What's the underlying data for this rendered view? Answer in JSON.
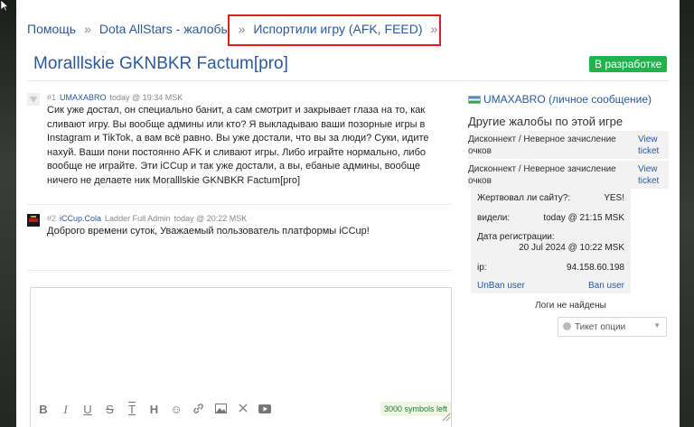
{
  "breadcrumbs": [
    {
      "label": "Помощь"
    },
    {
      "label": "Dota AllStars - жалобы"
    },
    {
      "label": "Испортили игру (AFK, FEED)"
    }
  ],
  "breadcrumb_separator": "»",
  "ticket": {
    "title": "Moralllskie GKNBKR Factum[pro]",
    "status": "В разработке"
  },
  "posts": [
    {
      "number": "#1",
      "author": "UMAXABRO",
      "role": "",
      "time": "today @ 19:34 MSK",
      "text": "Сик уже достал, он специально банит, а сам смотрит и закрывает глаза на то, как сливают игру. Вы вообще админы или кто? Я выкладываю ваши позорные игры в Instagram и TikTok, а вам всё равно. Вы уже достали, что вы за люди? Суки, идите нахуй. Ваши пони постоянно AFK и сливают игры. Либо играйте нормально, либо вообще не играйте. Эти iCCup и так уже достали, а вы, ебаные админы, вообще ничего не делаете ник Moralllskie GKNBKR Factum[pro]"
    },
    {
      "number": "#2",
      "author": "iCCup.Cola",
      "role": "Ladder Full Admin",
      "time": "today @ 20:22 MSK",
      "text": "Доброго времени суток, Уважаемый пользователь платформы iCCup!"
    }
  ],
  "editor": {
    "symbols_left": "3000 symbols left"
  },
  "sidebar": {
    "user_link": "UMAXABRO (личное сообщение)",
    "other_complaints_heading": "Другие жалобы по этой игре",
    "complaints": [
      {
        "text": "Дисконнект / Неверное зачисление очков",
        "link": "View ticket"
      },
      {
        "text": "Дисконнект / Неверное зачисление очков",
        "link": "View ticket"
      }
    ],
    "info": {
      "victim_label": "Жертвовал ли сайту?:",
      "victim_value": "YES!",
      "seen_label": "видели:",
      "seen_value": "today @ 21:15 MSK",
      "reg_label": "Дата регистрации:",
      "reg_value": "20 Jul 2024 @ 10:22 MSK",
      "ip_label": "ip:",
      "ip_value": "94.158.60.198"
    },
    "unban_link": "UnBan user",
    "ban_link": "Ban user",
    "no_logs": "Логи не найдены",
    "ticket_options": "Тикет опции"
  },
  "colors": {
    "link": "#2a5a9a",
    "status_badge": "#22b24c",
    "highlight_box": "#e21c1c",
    "sidebar_panel": "#f2f2f2"
  },
  "icons": {
    "toolbar": [
      "bold-icon",
      "italic-icon",
      "underline-icon",
      "strikethrough-icon",
      "text-format-icon",
      "heading-icon",
      "smiley-icon",
      "link-icon",
      "image-icon",
      "expand-icon",
      "video-icon"
    ],
    "avatars": [
      "default-avatar-icon",
      "admin-avatar-icon"
    ],
    "select": "gear-icon"
  }
}
